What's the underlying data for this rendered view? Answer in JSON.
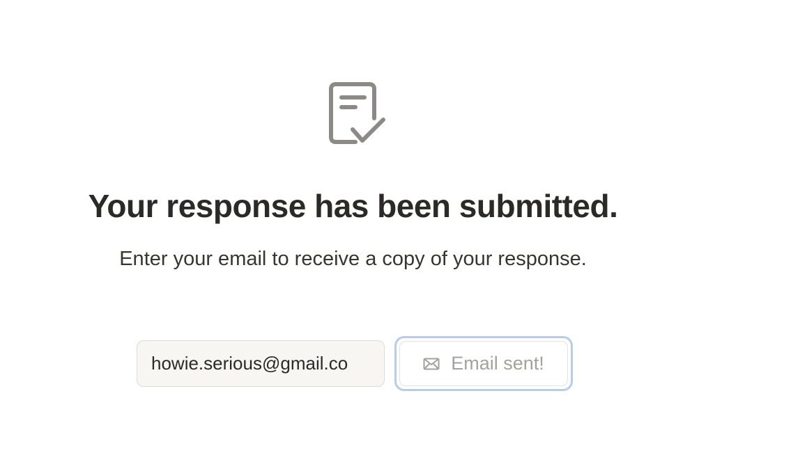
{
  "confirmation": {
    "icon": "form-check-icon",
    "title": "Your response has been submitted.",
    "subtitle": "Enter your email to receive a copy of your response."
  },
  "email_form": {
    "email_value": "howie.serious@gmail.co",
    "button_icon": "mail-icon",
    "button_label": "Email sent!"
  },
  "colors": {
    "icon_gray": "#8c8a86",
    "button_focus_ring": "#b6cdea",
    "input_background": "#f7f6f3"
  }
}
